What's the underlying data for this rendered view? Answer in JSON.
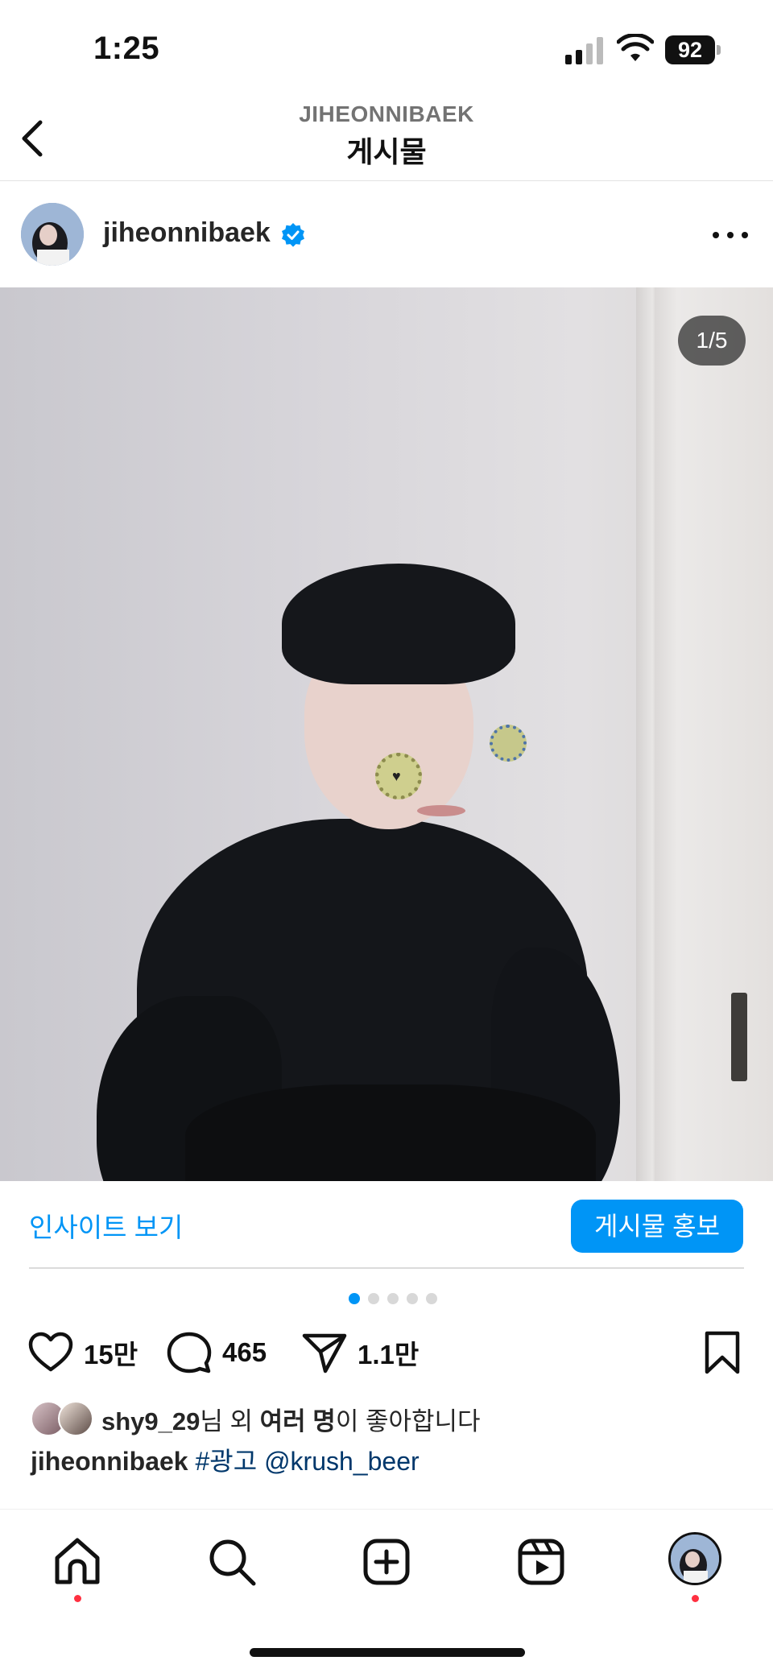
{
  "status_bar": {
    "time": "1:25",
    "battery": "92"
  },
  "header": {
    "username": "JIHEONNIBAEK",
    "title": "게시물"
  },
  "post": {
    "username": "jiheonnibaek",
    "verified": true,
    "page_counter": "1/5",
    "insights_label": "인사이트 보기",
    "promote_label": "게시물 홍보",
    "carousel": {
      "count": 5,
      "active": 1
    },
    "likes_count": "15만",
    "comments_count": "465",
    "shares_count": "1.1만",
    "liked_by": {
      "user": "shy9_29",
      "suffix_1": "님 외 ",
      "others": "여러 명",
      "suffix_2": "이 좋아합니다"
    },
    "caption": {
      "user": "jiheonnibaek",
      "hashtag": "#광고",
      "mention": "@krush_beer"
    }
  },
  "icons": {
    "back": "chevron-left-icon",
    "verified": "verified-badge-icon",
    "more": "more-horizontal-icon",
    "like": "heart-icon",
    "comment": "comment-icon",
    "share": "send-icon",
    "save": "bookmark-icon",
    "home": "home-icon",
    "search": "search-icon",
    "create": "plus-square-icon",
    "reels": "reels-icon"
  },
  "colors": {
    "accent": "#0095f6",
    "notification": "#ff3040",
    "tag": "#00376b"
  }
}
